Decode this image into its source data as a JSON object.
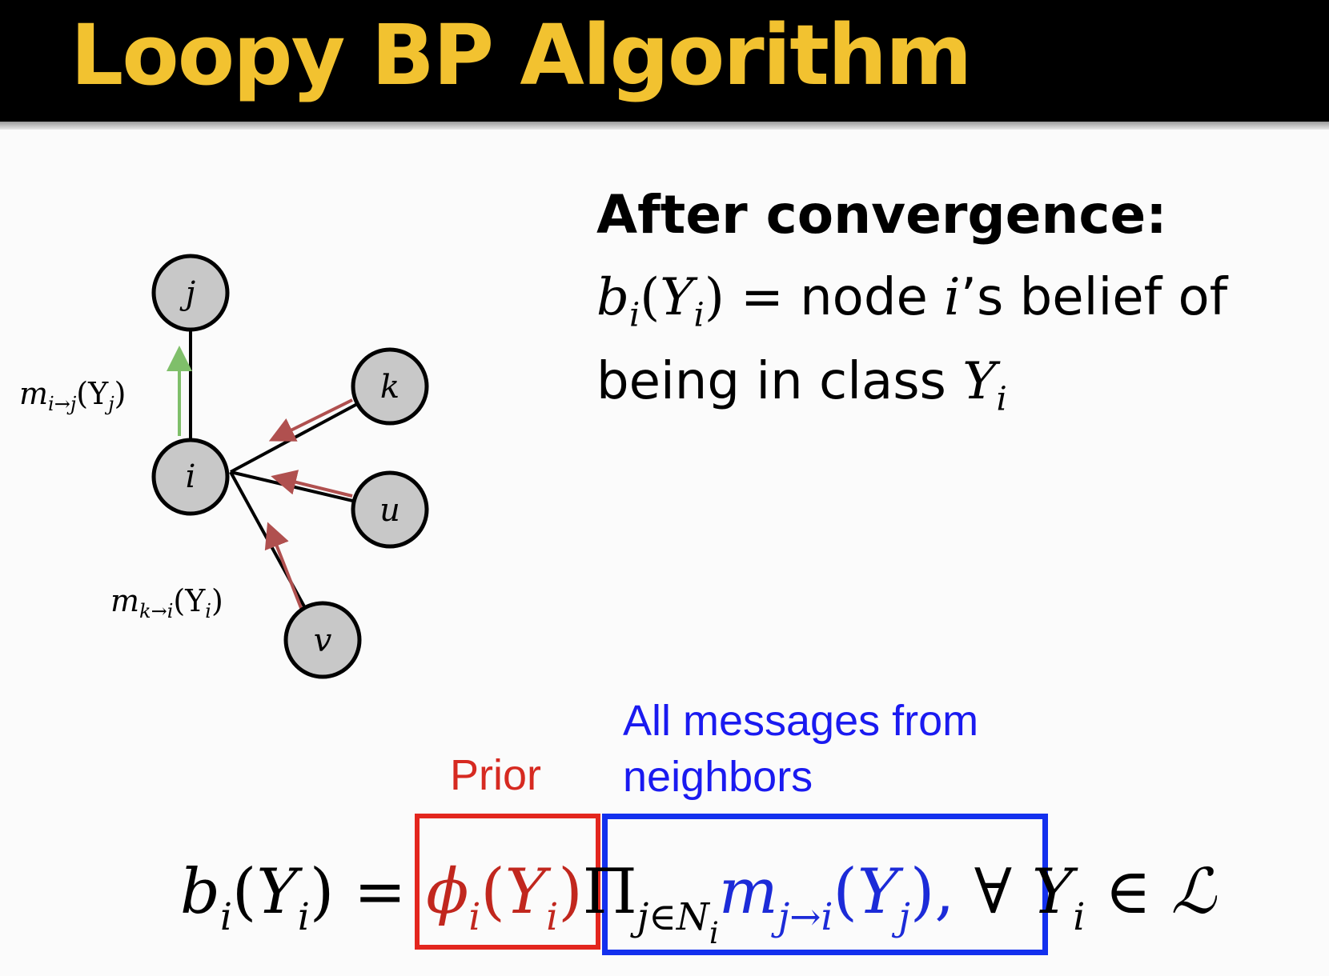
{
  "slide": {
    "title": "Loopy BP Algorithm"
  },
  "colors": {
    "title_text": "#f2c230",
    "title_background": "#000000",
    "prior": "#d62a21",
    "messages": "#1a1af0",
    "incoming_arrow": "#b0504f",
    "outgoing_arrow": "#7fbf6a",
    "node_fill": "#c8c8c8"
  },
  "graph": {
    "nodes": {
      "j": "j",
      "i": "i",
      "k": "k",
      "u": "u",
      "v": "v"
    },
    "labels": {
      "m_out_base": "m",
      "m_out_sub": "i→j",
      "m_out_arg_open": "(Y",
      "m_out_arg_sub": "j",
      "m_out_arg_close": ")",
      "m_in_base": "m",
      "m_in_sub": "k→i",
      "m_in_arg_open": "(Y",
      "m_in_arg_sub": "i",
      "m_in_arg_close": ")"
    }
  },
  "convergence": {
    "heading": "After convergence:",
    "b": "b",
    "b_sub": "i",
    "paren_open": "(",
    "Y": "Y",
    "Y_sub": "i",
    "paren_close": ")",
    "line1_text": " = node ",
    "i_var": "i",
    "line1_tail": "’s belief of",
    "line2_text": "being in class ",
    "line2_Y": "Y",
    "line2_Y_sub": "i"
  },
  "annotations": {
    "prior": "Prior",
    "messages": "All messages from neighbors"
  },
  "formula": {
    "lhs_b": "b",
    "lhs_b_sub": "i",
    "lhs_open": "(",
    "lhs_Y": "Y",
    "lhs_Y_sub": "i",
    "lhs_close": ")",
    "equals": " = ",
    "phi": "ϕ",
    "phi_sub": "i",
    "phi_open": "(",
    "phi_Y": "Y",
    "phi_Y_sub": "i",
    "phi_close": ")",
    "prod": "Π",
    "prod_sub": "j∈N",
    "prod_sub_sub": "i",
    "m": "m",
    "m_sub": "j→i",
    "m_open": "(",
    "m_Y": "Y",
    "m_Y_sub": "j",
    "m_close": ")",
    "comma": ",",
    "forall": " ∀ ",
    "tail_Y": "Y",
    "tail_Y_sub": "i",
    "tail_in": " ∈ ",
    "tail_set": "ℒ"
  }
}
